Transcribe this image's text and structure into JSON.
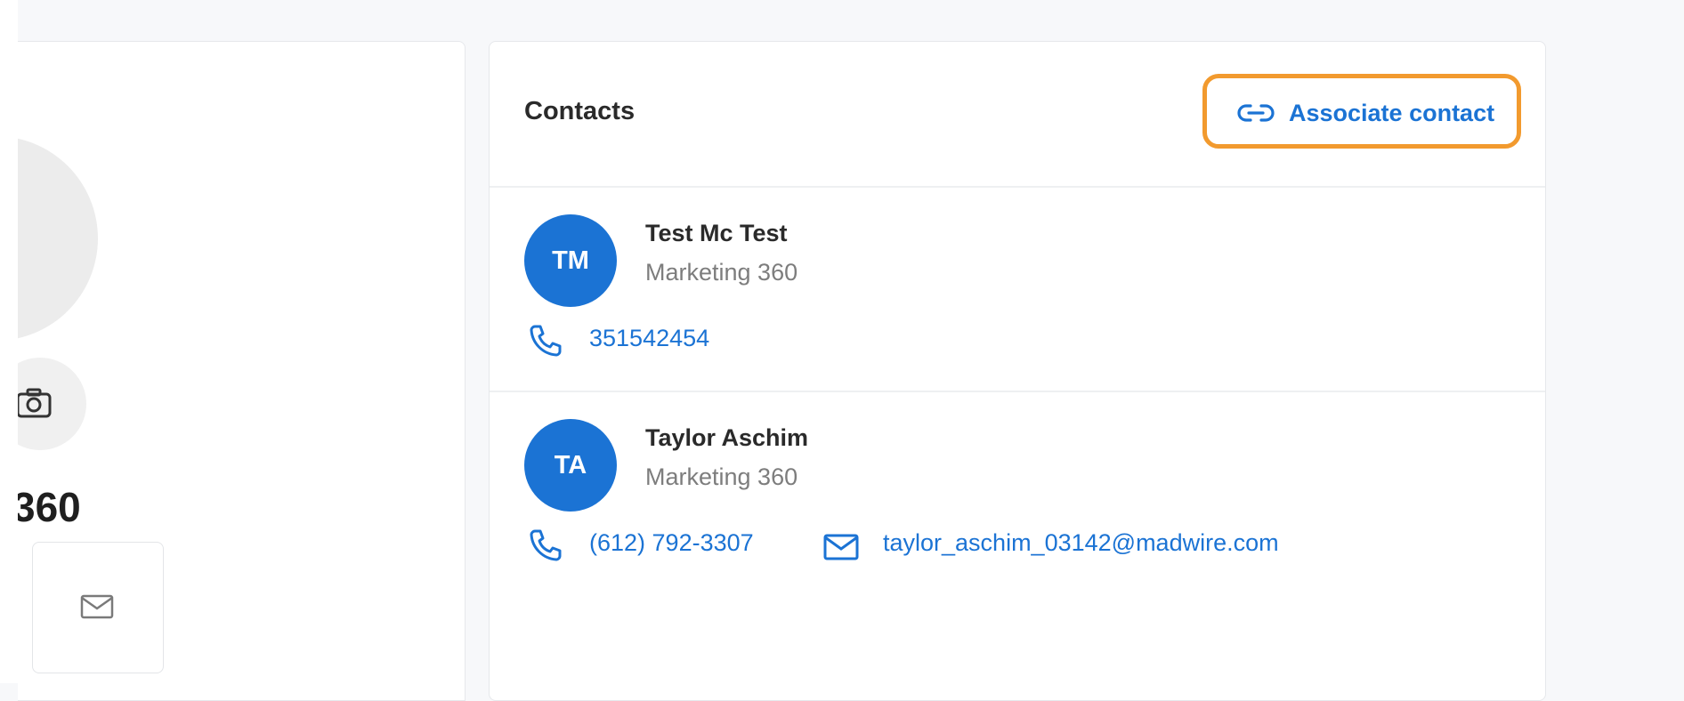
{
  "company_panel": {
    "name_visible": "360",
    "camera_icon": "camera-icon",
    "mail_icon": "mail-icon"
  },
  "contacts": {
    "title": "Contacts",
    "associate_label": "Associate contact",
    "associate_icon": "link-icon",
    "items": [
      {
        "initials": "TM",
        "name": "Test Mc Test",
        "company": "Marketing 360",
        "phone": "351542454"
      },
      {
        "initials": "TA",
        "name": "Taylor Aschim",
        "company": "Marketing 360",
        "phone": "(612) 792-3307",
        "email": "taylor_aschim_03142@madwire.com"
      }
    ]
  },
  "colors": {
    "accent": "#1b73d4",
    "highlight": "#f29a2e",
    "muted_text": "#7d7d7d",
    "background": "#f7f8fa"
  }
}
